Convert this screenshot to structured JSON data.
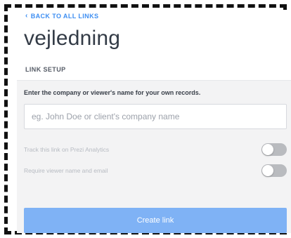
{
  "back_link": {
    "label": "BACK TO ALL LINKS",
    "icon": "chevron-left-icon"
  },
  "title": "vejledning",
  "section": {
    "label": "LINK SETUP"
  },
  "form": {
    "field_label": "Enter the company or viewer's name for your own records.",
    "input_value": "",
    "input_placeholder": "eg. John Doe or client's company name",
    "toggles": [
      {
        "label": "Track this link on Prezi Analytics",
        "on": false
      },
      {
        "label": "Require viewer name and email",
        "on": false
      }
    ],
    "submit_label": "Create link"
  },
  "colors": {
    "accent": "#3d8ef2",
    "button": "#7fb2f5",
    "toggle_off": "#b9bbbf",
    "panel_bg": "#f3f3f4"
  }
}
